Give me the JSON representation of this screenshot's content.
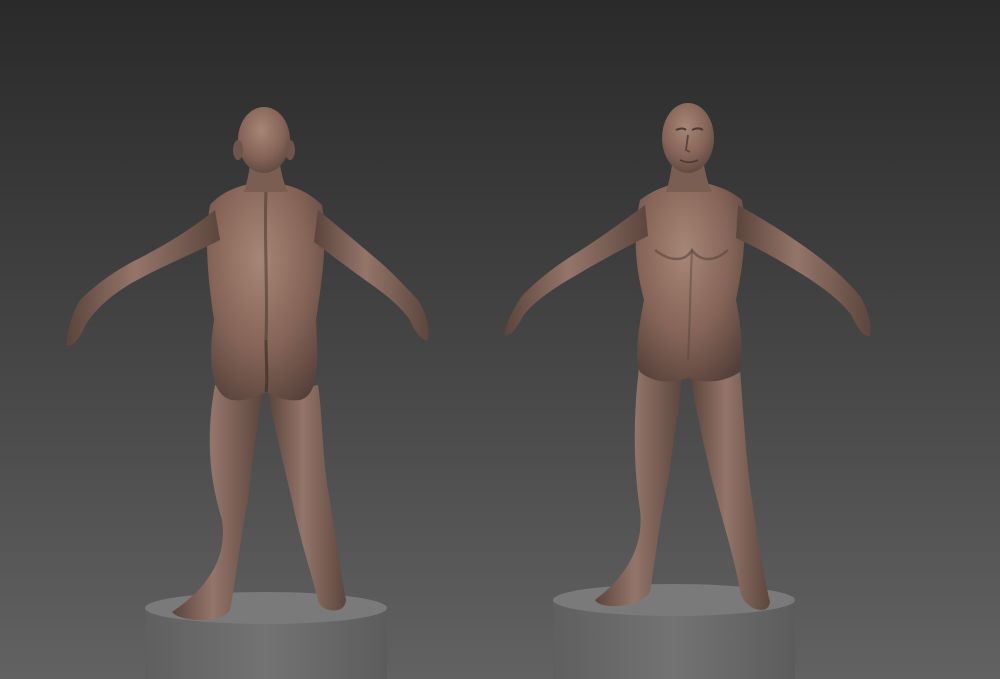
{
  "scene": {
    "background_top": "#2a2a2a",
    "background_bottom": "#5e5e5e",
    "clay_color": "#8a6a5c",
    "clay_shadow": "#4e3a32",
    "clay_highlight": "#a88878",
    "pedestal_color": "#707070",
    "pedestal_top": "#7c7c7c"
  },
  "figures": [
    {
      "view": "back",
      "icon": "human-sculpt-back-view"
    },
    {
      "view": "front",
      "icon": "human-sculpt-front-view"
    }
  ]
}
